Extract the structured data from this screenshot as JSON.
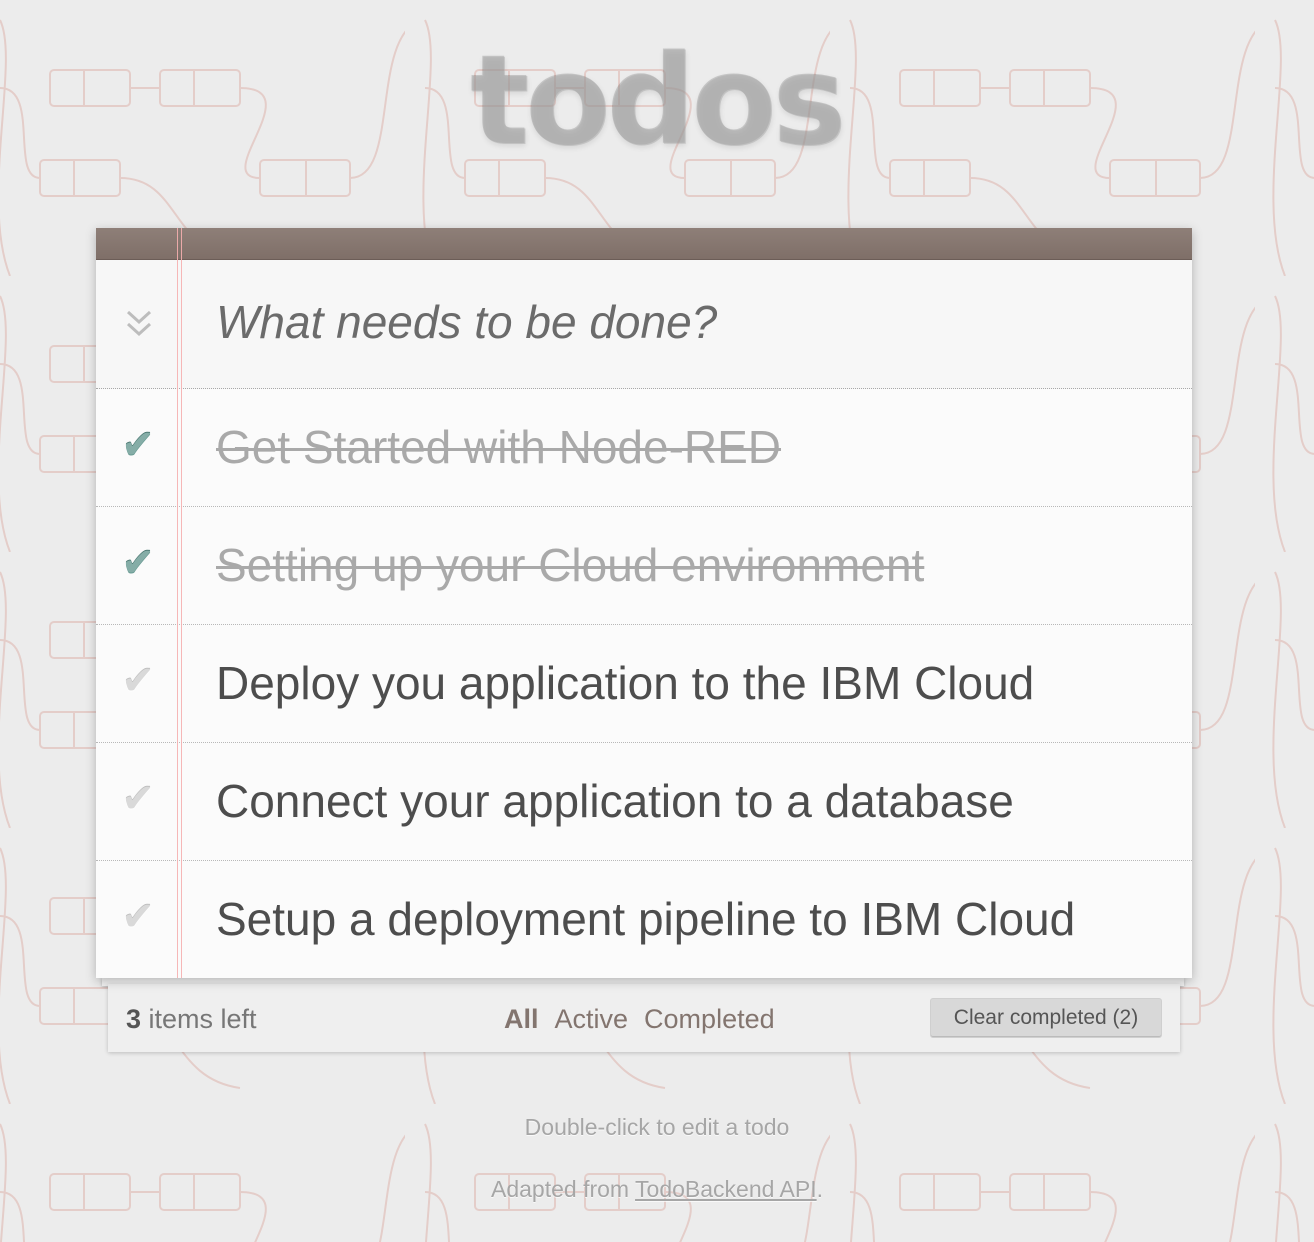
{
  "app": {
    "title": "todos"
  },
  "new_todo": {
    "placeholder": "What needs to be done?",
    "value": ""
  },
  "todos": [
    {
      "text": "Get Started with Node-RED",
      "completed": true
    },
    {
      "text": "Setting up your Cloud environment",
      "completed": true
    },
    {
      "text": "Deploy you application to the IBM Cloud",
      "completed": false
    },
    {
      "text": "Connect your application to a database",
      "completed": false
    },
    {
      "text": "Setup a deployment pipeline to IBM Cloud",
      "completed": false
    }
  ],
  "icons": {
    "toggle_all": "double-chevron-down-icon",
    "checkbox": "checkmark-icon"
  },
  "footer": {
    "count": "3",
    "count_suffix": " items left",
    "filters": [
      {
        "label": "All",
        "selected": true
      },
      {
        "label": "Active",
        "selected": false
      },
      {
        "label": "Completed",
        "selected": false
      }
    ],
    "clear_completed": "Clear completed (2)"
  },
  "info": {
    "hint": "Double-click to edit a todo",
    "adapted_prefix": "Adapted from ",
    "adapted_link": "TodoBackend API",
    "adapted_suffix": "."
  },
  "colors": {
    "header_bar": "#8e7f78",
    "check_done": "#85ada7",
    "check_undone": "#d9d9d9",
    "completed_text": "#a9a9a9",
    "filter_link": "#83756f",
    "background": "#ececec"
  }
}
